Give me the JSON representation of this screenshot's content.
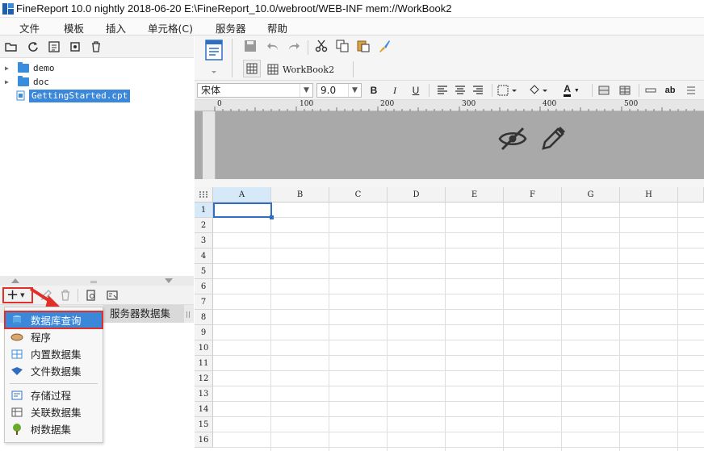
{
  "window": {
    "title": "FineReport 10.0 nightly 2018-06-20 E:\\FineReport_10.0/webroot/WEB-INF    mem://WorkBook2"
  },
  "menubar": {
    "items": [
      "文件",
      "模板",
      "插入",
      "单元格(C)",
      "服务器",
      "帮助"
    ]
  },
  "file_tree": {
    "items": [
      {
        "label": "demo",
        "type": "folder"
      },
      {
        "label": "doc",
        "type": "folder"
      },
      {
        "label": "GettingStarted.cpt",
        "type": "file",
        "selected": true
      }
    ]
  },
  "dataset_panel": {
    "tab_label": "服务器数据集",
    "add_menu": [
      {
        "label": "数据库查询",
        "icon": "database-icon",
        "highlighted": true
      },
      {
        "label": "程序",
        "icon": "program-icon"
      },
      {
        "label": "内置数据集",
        "icon": "builtin-dataset-icon"
      },
      {
        "label": "文件数据集",
        "icon": "file-dataset-icon"
      },
      {
        "label": "存储过程",
        "icon": "stored-procedure-icon"
      },
      {
        "label": "关联数据集",
        "icon": "relation-dataset-icon"
      },
      {
        "label": "树数据集",
        "icon": "tree-dataset-icon"
      }
    ]
  },
  "editor": {
    "tab_label": "WorkBook2",
    "font_name": "宋体",
    "font_size": "9.0",
    "ruler_ticks": [
      "0",
      "100",
      "200",
      "300",
      "400",
      "500"
    ],
    "columns": [
      "A",
      "B",
      "C",
      "D",
      "E",
      "F",
      "G",
      "H"
    ],
    "rows": [
      "1",
      "2",
      "3",
      "4",
      "5",
      "6",
      "7",
      "8",
      "9",
      "10",
      "11",
      "12",
      "13",
      "14",
      "15",
      "16"
    ]
  },
  "colors": {
    "accent": "#3b87d9",
    "highlight_box": "#e0302a"
  }
}
